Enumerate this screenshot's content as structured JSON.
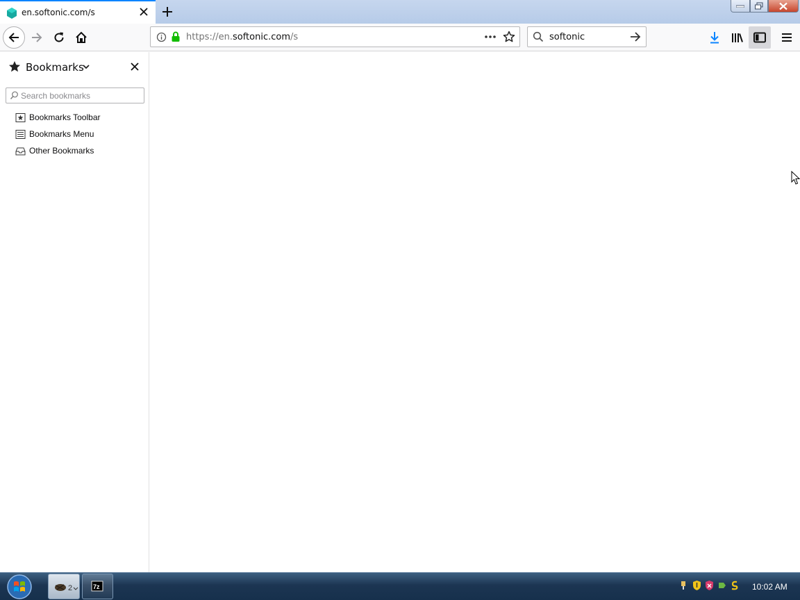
{
  "browser": {
    "tab": {
      "title": "en.softonic.com/s",
      "favicon": "softonic-favicon"
    },
    "url": {
      "scheme": "https://",
      "host_prefix": "en.",
      "host": "softonic.com",
      "path": "/s"
    },
    "search": {
      "query": "softonic"
    }
  },
  "sidebar": {
    "title": "Bookmarks",
    "search_placeholder": "Search bookmarks",
    "items": [
      {
        "label": "Bookmarks Toolbar",
        "icon": "bookmarks-toolbar-icon"
      },
      {
        "label": "Bookmarks Menu",
        "icon": "bookmarks-menu-icon"
      },
      {
        "label": "Other Bookmarks",
        "icon": "other-bookmarks-icon"
      }
    ]
  },
  "taskbar": {
    "task_1_badge": "2",
    "task_2_label": "7z",
    "clock": "10:02 AM"
  },
  "colors": {
    "accent": "#0a84ff",
    "secure": "#12bc00",
    "download": "#0a84ff"
  }
}
